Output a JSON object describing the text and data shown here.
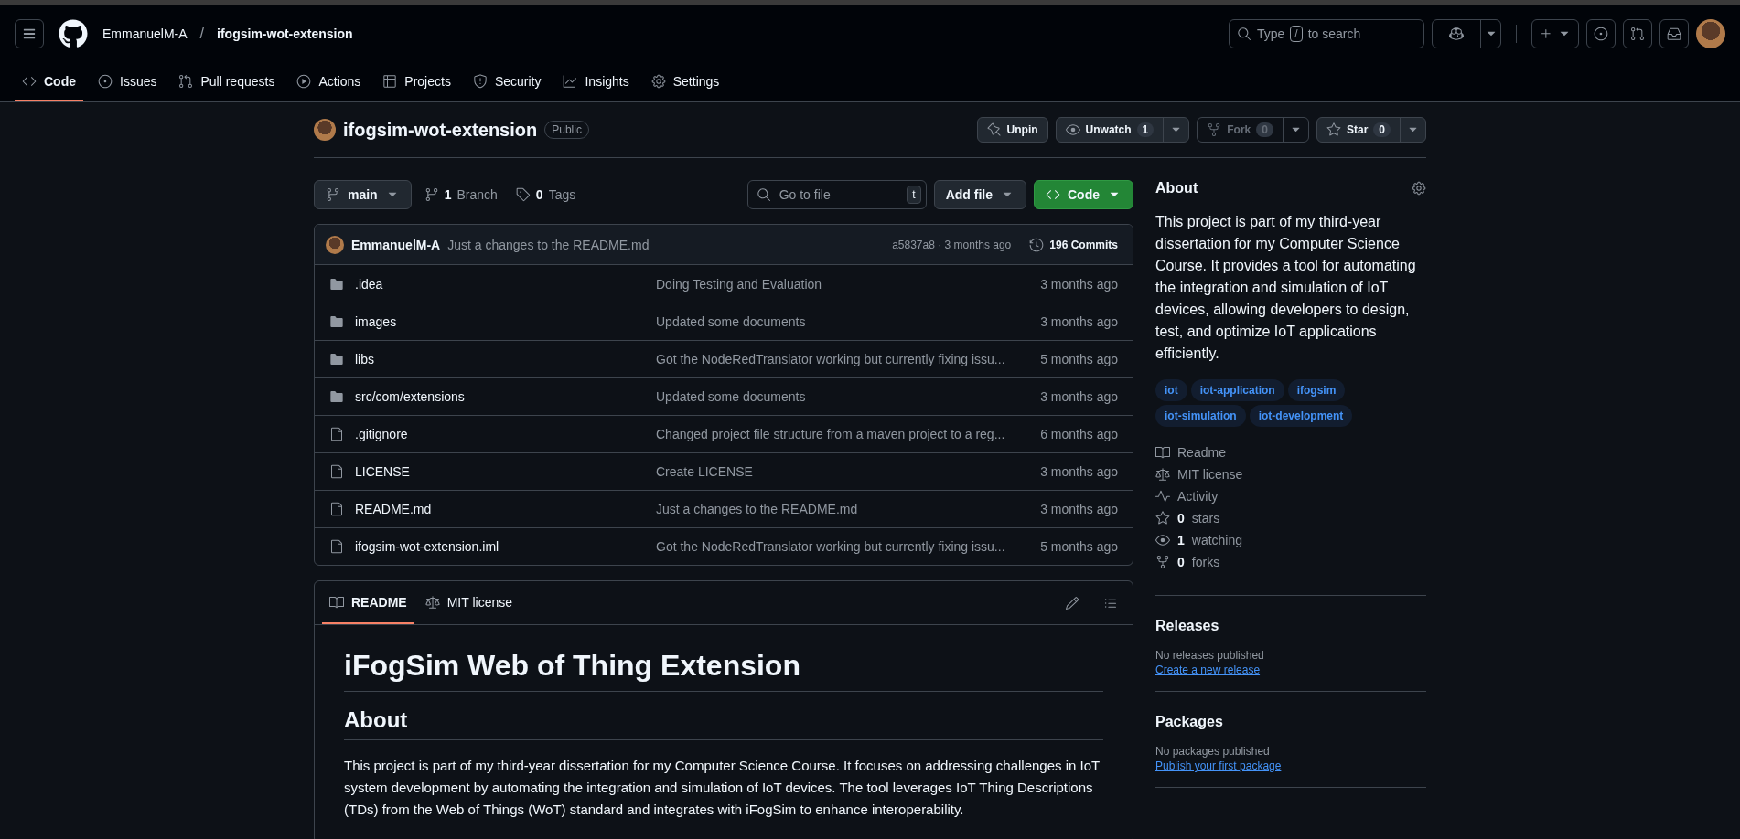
{
  "header": {
    "owner": "EmmanuelM-A",
    "separator": "/",
    "repo": "ifogsim-wot-extension",
    "search": {
      "before": "Type",
      "key": "/",
      "after": "to search"
    }
  },
  "nav_tabs": [
    {
      "label": "Code",
      "kind": "code",
      "selected": true
    },
    {
      "label": "Issues",
      "kind": "issue",
      "selected": false
    },
    {
      "label": "Pull requests",
      "kind": "pr",
      "selected": false
    },
    {
      "label": "Actions",
      "kind": "play",
      "selected": false
    },
    {
      "label": "Projects",
      "kind": "table",
      "selected": false
    },
    {
      "label": "Security",
      "kind": "shield",
      "selected": false
    },
    {
      "label": "Insights",
      "kind": "graph",
      "selected": false
    },
    {
      "label": "Settings",
      "kind": "gear",
      "selected": false
    }
  ],
  "repo": {
    "name": "ifogsim-wot-extension",
    "visibility": "Public",
    "actions": [
      {
        "label": "Unpin",
        "kind": "pin",
        "disabled": false
      },
      {
        "label": "Unwatch",
        "kind": "eye",
        "count": "1",
        "disabled": false
      },
      {
        "label": "Fork",
        "kind": "fork",
        "count": "0",
        "disabled": true
      },
      {
        "label": "Star",
        "kind": "star",
        "count": "0",
        "disabled": false
      }
    ]
  },
  "toolbar": {
    "branch": "main",
    "branches": {
      "count": "1",
      "label": "Branch"
    },
    "tags": {
      "count": "0",
      "label": "Tags"
    },
    "go_to_file": {
      "placeholder": "Go to file",
      "shortcut": "t"
    },
    "add_file": "Add file",
    "code_button": "Code"
  },
  "commit": {
    "author": "EmmanuelM-A",
    "message": "Just a changes to the README.md",
    "hash_time": "a5837a8 · 3 months ago",
    "commits_count": "196",
    "commits_label": "Commits"
  },
  "files": [
    {
      "kind": "folder",
      "name": ".idea",
      "message": "Doing Testing and Evaluation",
      "time": "3 months ago"
    },
    {
      "kind": "folder",
      "name": "images",
      "message": "Updated some documents",
      "time": "3 months ago"
    },
    {
      "kind": "folder",
      "name": "libs",
      "message": "Got the NodeRedTranslator working but currently fixing issu...",
      "time": "5 months ago"
    },
    {
      "kind": "folder",
      "name": "src/com/extensions",
      "message": "Updated some documents",
      "time": "3 months ago"
    },
    {
      "kind": "file",
      "name": ".gitignore",
      "message": "Changed project file structure from a maven project to a reg...",
      "time": "6 months ago"
    },
    {
      "kind": "file",
      "name": "LICENSE",
      "message": "Create LICENSE",
      "time": "3 months ago"
    },
    {
      "kind": "file",
      "name": "README.md",
      "message": "Just a changes to the README.md",
      "time": "3 months ago"
    },
    {
      "kind": "file",
      "name": "ifogsim-wot-extension.iml",
      "message": "Got the NodeRedTranslator working but currently fixing issu...",
      "time": "5 months ago"
    }
  ],
  "readme": {
    "tabs": [
      {
        "label": "README",
        "kind": "book",
        "selected": true
      },
      {
        "label": "MIT license",
        "kind": "law",
        "selected": false
      }
    ],
    "title": "iFogSim Web of Thing Extension",
    "heading": "About",
    "paragraph": "This project is part of my third-year dissertation for my Computer Science Course. It focuses on addressing challenges in IoT system development by automating the integration and simulation of IoT devices. The tool leverages IoT Thing Descriptions (TDs) from the Web of Things (WoT) standard and integrates with iFogSim to enhance interoperability."
  },
  "about": {
    "title": "About",
    "description": "This project is part of my third-year dissertation for my Computer Science Course. It provides a tool for automating the integration and simulation of IoT devices, allowing developers to design, test, and optimize IoT applications efficiently.",
    "topics": [
      "iot",
      "iot-application",
      "ifogsim",
      "iot-simulation",
      "iot-development"
    ],
    "links": [
      {
        "kind": "book",
        "label": "Readme"
      },
      {
        "kind": "law",
        "label": "MIT license"
      },
      {
        "kind": "pulse",
        "label": "Activity"
      },
      {
        "kind": "star",
        "count": "0",
        "label": "stars"
      },
      {
        "kind": "eye",
        "count": "1",
        "label": "watching"
      },
      {
        "kind": "fork",
        "count": "0",
        "label": "forks"
      }
    ]
  },
  "releases": {
    "title": "Releases",
    "note": "No releases published",
    "link": "Create a new release"
  },
  "packages": {
    "title": "Packages",
    "note": "No packages published",
    "link": "Publish your first package"
  }
}
